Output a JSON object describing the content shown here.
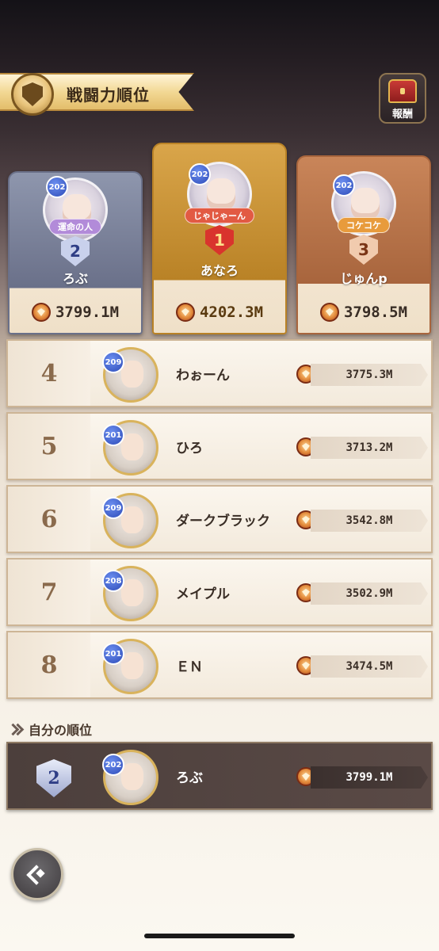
{
  "header": {
    "title": "戦闘力順位",
    "reward_label": "報酬"
  },
  "top3": [
    {
      "rank": "2",
      "level": "202",
      "title": "運命の人",
      "name": "ろぶ",
      "power": "3799.1M",
      "colors": {
        "panel": "#8e96ad",
        "panel_dark": "#6a7089",
        "ribbon": "#b28bd9",
        "shield": "#c9d1ec",
        "shield_text": "#2f3e86"
      }
    },
    {
      "rank": "1",
      "level": "202",
      "title": "じゃじゃーん",
      "name": "あなろ",
      "power": "4202.3M",
      "colors": {
        "panel": "#d9a54a",
        "panel_dark": "#b98226",
        "ribbon": "#e25a43",
        "shield": "#d9342d",
        "shield_text": "#ffe18a"
      }
    },
    {
      "rank": "3",
      "level": "202",
      "title": "コケコケ",
      "name": "じゅんp",
      "power": "3798.5M",
      "colors": {
        "panel": "#c98559",
        "panel_dark": "#a8653d",
        "ribbon": "#e89b3c",
        "shield": "#f1cbae",
        "shield_text": "#7a3516"
      }
    }
  ],
  "ranking": [
    {
      "rank": "4",
      "level": "209",
      "name": "わぉーん",
      "power": "3775.3M"
    },
    {
      "rank": "5",
      "level": "201",
      "name": "ひろ",
      "power": "3713.2M"
    },
    {
      "rank": "6",
      "level": "209",
      "name": "ダークブラック",
      "power": "3542.8M"
    },
    {
      "rank": "7",
      "level": "208",
      "name": "メイプル",
      "power": "3502.9M"
    },
    {
      "rank": "8",
      "level": "201",
      "name": "ＥＮ",
      "power": "3474.5M"
    }
  ],
  "my_rank": {
    "label": "自分の順位",
    "rank": "2",
    "level": "202",
    "name": "ろぶ",
    "power": "3799.1M"
  }
}
